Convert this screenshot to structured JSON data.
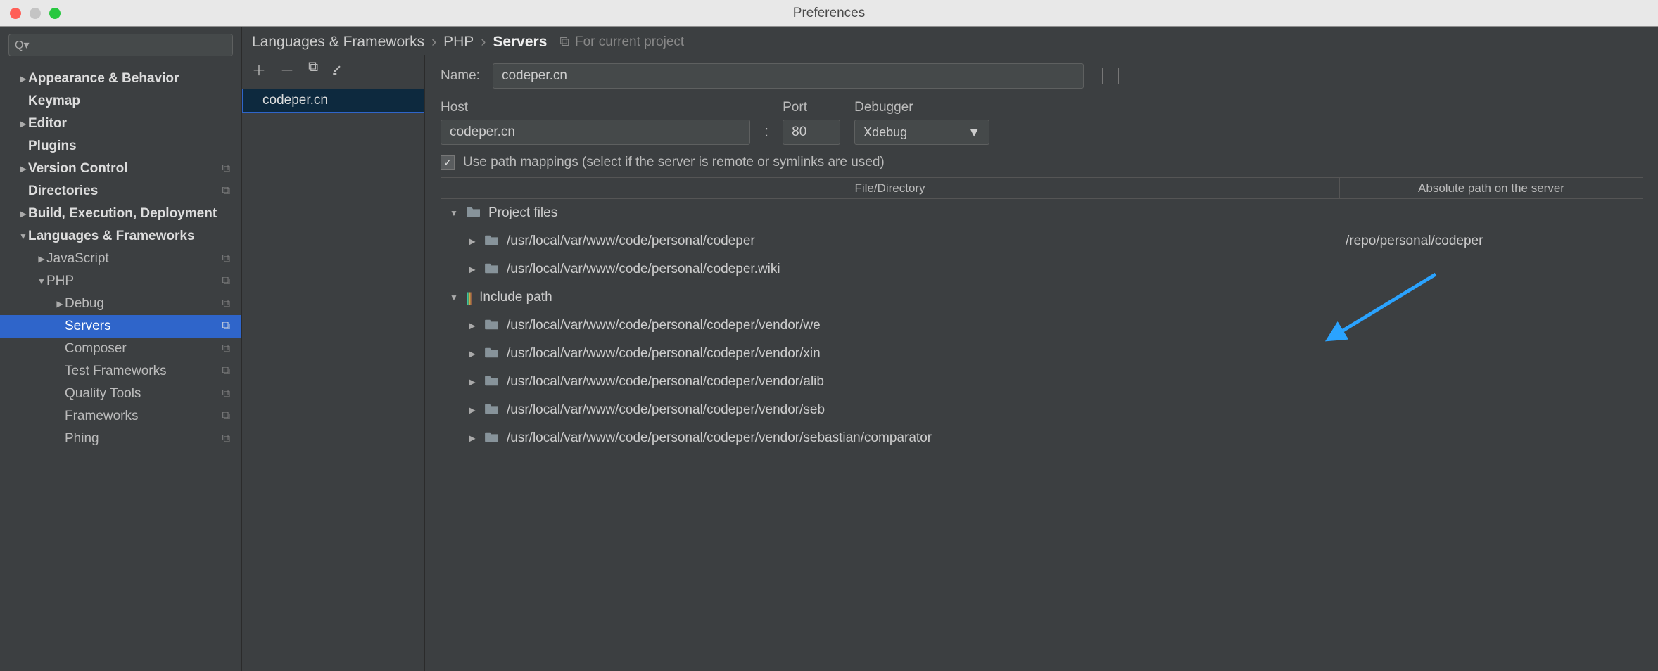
{
  "window": {
    "title": "Preferences"
  },
  "breadcrumb": {
    "a": "Languages & Frameworks",
    "b": "PHP",
    "c": "Servers"
  },
  "projectIndicator": "For current project",
  "sidebar": {
    "items": [
      {
        "label": "Appearance & Behavior",
        "depth": 0,
        "expandable": true,
        "expanded": false,
        "bold": true
      },
      {
        "label": "Keymap",
        "depth": 0,
        "bold": true
      },
      {
        "label": "Editor",
        "depth": 0,
        "expandable": true,
        "expanded": false,
        "bold": true
      },
      {
        "label": "Plugins",
        "depth": 0,
        "bold": true
      },
      {
        "label": "Version Control",
        "depth": 0,
        "expandable": true,
        "expanded": false,
        "bold": true,
        "badge": true
      },
      {
        "label": "Directories",
        "depth": 0,
        "bold": true,
        "badge": true
      },
      {
        "label": "Build, Execution, Deployment",
        "depth": 0,
        "expandable": true,
        "expanded": false,
        "bold": true
      },
      {
        "label": "Languages & Frameworks",
        "depth": 0,
        "expandable": true,
        "expanded": true,
        "bold": true
      },
      {
        "label": "JavaScript",
        "depth": 1,
        "expandable": true,
        "expanded": false,
        "badge": true
      },
      {
        "label": "PHP",
        "depth": 1,
        "expandable": true,
        "expanded": true,
        "badge": true
      },
      {
        "label": "Debug",
        "depth": 2,
        "expandable": true,
        "expanded": false,
        "badge": true
      },
      {
        "label": "Servers",
        "depth": 2,
        "selected": true,
        "badge": true
      },
      {
        "label": "Composer",
        "depth": 2,
        "badge": true
      },
      {
        "label": "Test Frameworks",
        "depth": 2,
        "badge": true
      },
      {
        "label": "Quality Tools",
        "depth": 2,
        "badge": true
      },
      {
        "label": "Frameworks",
        "depth": 2,
        "badge": true
      },
      {
        "label": "Phing",
        "depth": 2,
        "badge": true
      }
    ]
  },
  "serverList": {
    "items": [
      "codeper.cn"
    ]
  },
  "form": {
    "nameLabel": "Name:",
    "name": "codeper.cn",
    "hostLabel": "Host",
    "host": "codeper.cn",
    "portLabel": "Port",
    "port": "80",
    "debuggerLabel": "Debugger",
    "debugger": "Xdebug",
    "pathMapLabel": "Use path mappings (select if the server is remote or symlinks are used)",
    "colFile": "File/Directory",
    "colAbs": "Absolute path on the server"
  },
  "mappings": [
    {
      "indent": 0,
      "arrow": "down",
      "icon": "folder",
      "label": "Project files",
      "abs": ""
    },
    {
      "indent": 1,
      "arrow": "right",
      "icon": "folder",
      "label": "/usr/local/var/www/code/personal/codeper",
      "abs": "/repo/personal/codeper"
    },
    {
      "indent": 1,
      "arrow": "right",
      "icon": "folder",
      "label": "/usr/local/var/www/code/personal/codeper.wiki",
      "abs": ""
    },
    {
      "indent": 0,
      "arrow": "down",
      "icon": "lib",
      "label": "Include path",
      "abs": ""
    },
    {
      "indent": 1,
      "arrow": "right",
      "icon": "folder",
      "label": "/usr/local/var/www/code/personal/codeper/vendor/we",
      "abs": ""
    },
    {
      "indent": 1,
      "arrow": "right",
      "icon": "folder",
      "label": "/usr/local/var/www/code/personal/codeper/vendor/xin",
      "abs": ""
    },
    {
      "indent": 1,
      "arrow": "right",
      "icon": "folder",
      "label": "/usr/local/var/www/code/personal/codeper/vendor/alib",
      "abs": ""
    },
    {
      "indent": 1,
      "arrow": "right",
      "icon": "folder",
      "label": "/usr/local/var/www/code/personal/codeper/vendor/seb",
      "abs": ""
    },
    {
      "indent": 1,
      "arrow": "right",
      "icon": "folder",
      "label": "/usr/local/var/www/code/personal/codeper/vendor/sebastian/comparator",
      "abs": ""
    }
  ]
}
